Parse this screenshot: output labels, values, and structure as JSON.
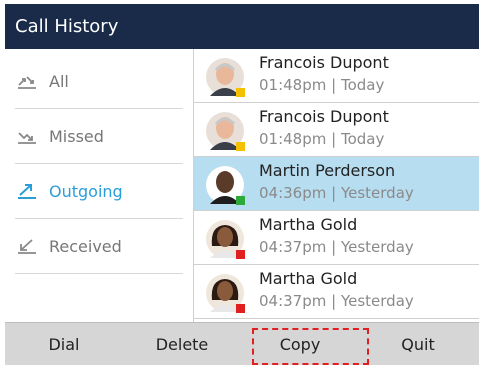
{
  "title": "Call History",
  "filters": [
    {
      "label": "All",
      "icon": "all-calls-icon",
      "active": false
    },
    {
      "label": "Missed",
      "icon": "missed-call-icon",
      "active": false
    },
    {
      "label": "Outgoing",
      "icon": "outgoing-call-icon",
      "active": true
    },
    {
      "label": "Received",
      "icon": "received-call-icon",
      "active": false
    }
  ],
  "calls": [
    {
      "name": "Francois Dupont",
      "meta": "01:48pm | Today",
      "status_color": "#f5c000",
      "selected": false
    },
    {
      "name": "Francois Dupont",
      "meta": "01:48pm | Today",
      "status_color": "#f5c000",
      "selected": false
    },
    {
      "name": "Martin Perderson",
      "meta": "04:36pm | Yesterday",
      "status_color": "#2eaa3a",
      "selected": true
    },
    {
      "name": "Martha Gold",
      "meta": "04:37pm | Yesterday",
      "status_color": "#e02020",
      "selected": false
    },
    {
      "name": "Martha Gold",
      "meta": "04:37pm | Yesterday",
      "status_color": "#e02020",
      "selected": false
    }
  ],
  "softkeys": {
    "dial": "Dial",
    "delete": "Delete",
    "copy": "Copy",
    "quit": "Quit"
  },
  "colors": {
    "title_bg": "#1a2b4a",
    "accent": "#2a9ed8",
    "selected_row": "#b7ddf0",
    "highlight": "#e02020"
  }
}
